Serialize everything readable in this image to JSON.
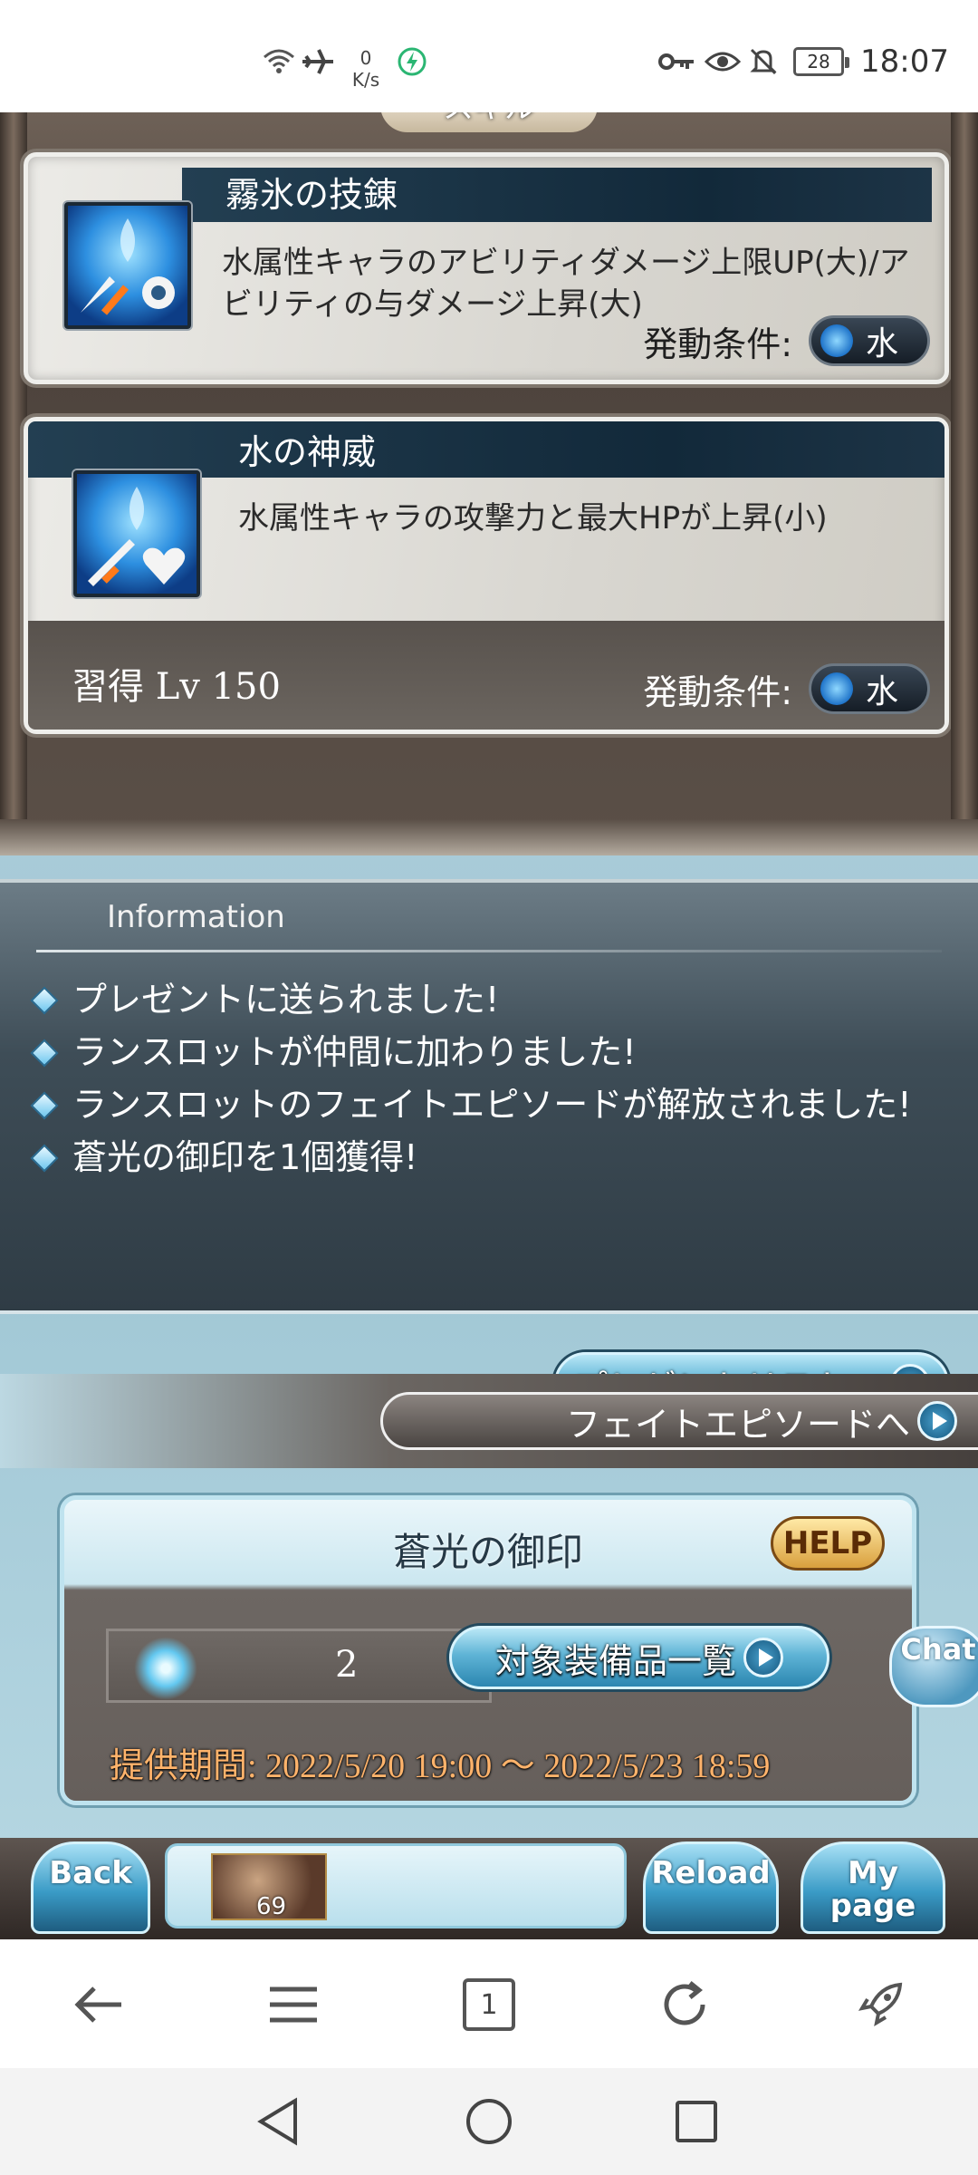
{
  "status_bar": {
    "net_speed_value": "0",
    "net_speed_unit": "K/s",
    "battery": "28",
    "time": "18:07",
    "icons": [
      "wifi-icon",
      "airplane-icon",
      "charging-icon",
      "key-icon",
      "eye-icon",
      "bell-off-icon",
      "battery-icon"
    ]
  },
  "skills": {
    "frame_title": "スキル",
    "items": [
      {
        "name": "霧氷の技錬",
        "description": "水属性キャラのアビリティダメージ上限UP(大)/アビリティの与ダメージ上昇(大)",
        "condition_label": "発動条件:",
        "element": "水"
      },
      {
        "name": "水の神威",
        "description": "水属性キャラの攻撃力と最大HPが上昇(小)",
        "acquire": "習得 Lv 150",
        "condition_label": "発動条件:",
        "element": "水"
      }
    ]
  },
  "information": {
    "title": "Information",
    "items": [
      "プレゼントに送られました!",
      "ランスロットが仲間に加わりました!",
      "ランスロットのフェイトエピソードが解放されました!",
      "蒼光の御印を1個獲得!"
    ],
    "present_button": "プレゼントリストへ"
  },
  "fate_button": "フェイトエピソードへ",
  "seal": {
    "title": "蒼光の御印",
    "help": "HELP",
    "count": "2",
    "equipment_button": "対象装備品一覧",
    "period": "提供期間: 2022/5/20 19:00 〜 2022/5/23 18:59"
  },
  "chat_button": "Chat",
  "game_footer": {
    "back": "Back",
    "reload": "Reload",
    "my_page_line1": "My",
    "my_page_line2": "page",
    "avatar_level": "69"
  },
  "browser_bar": {
    "tab_count": "1"
  },
  "colors": {
    "accent_blue": "#3a9bc6",
    "info_bg": "#3e4d57",
    "period_text": "#ffb36b",
    "skill_header": "#12293a"
  }
}
